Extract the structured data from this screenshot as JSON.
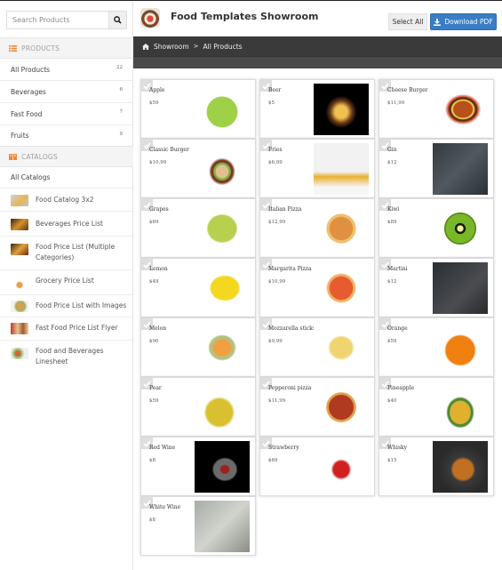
{
  "sidebar": {
    "search_placeholder": "Search Products",
    "search_icon": "search-icon",
    "products_heading": "PRODUCTS",
    "products_icon": "list-icon",
    "product_categories": [
      {
        "label": "All Products",
        "count": "22"
      },
      {
        "label": "Beverages",
        "count": "6"
      },
      {
        "label": "Fast Food",
        "count": "7"
      },
      {
        "label": "Fruits",
        "count": "9"
      }
    ],
    "catalogs_heading": "CATALOGS",
    "catalogs_icon": "book-icon",
    "all_catalogs_label": "All Catalogs",
    "catalogs": [
      {
        "label": "Food Catalog 3x2"
      },
      {
        "label": "Beverages Price List"
      },
      {
        "label": "Food Price List (Multiple Categories)"
      },
      {
        "label": "Grocery Price List"
      },
      {
        "label": "Food Price List with Images"
      },
      {
        "label": "Fast Food Price List Flyer"
      },
      {
        "label": "Food and Beverages Linesheet"
      }
    ]
  },
  "header": {
    "title": "Food Templates Showroom",
    "select_all_label": "Select All",
    "download_pdf_label": "Download PDF",
    "download_icon": "download-icon"
  },
  "breadcrumb": {
    "home_icon": "home-icon",
    "items": [
      "Showroom",
      "All Products"
    ],
    "separator": ">"
  },
  "colors": {
    "accent": "#3b7dc4",
    "header_dark": "#3a3a3a",
    "products_icon": "#f0883a",
    "catalogs_icon": "#f0883a"
  },
  "products": [
    {
      "name": "Apple",
      "price": "$59"
    },
    {
      "name": "Beer",
      "price": "$5"
    },
    {
      "name": "Cheese Burger",
      "price": "$11,99"
    },
    {
      "name": "Classic Burger",
      "price": "$10,99"
    },
    {
      "name": "Fries",
      "price": "$6,99"
    },
    {
      "name": "Gin",
      "price": "$12"
    },
    {
      "name": "Grapes",
      "price": "$69"
    },
    {
      "name": "Italian Pizza",
      "price": "$12,99"
    },
    {
      "name": "Kiwi",
      "price": "$89"
    },
    {
      "name": "Lemon",
      "price": "$49"
    },
    {
      "name": "Margarita Pizza",
      "price": "$10,99"
    },
    {
      "name": "Martini",
      "price": "$12"
    },
    {
      "name": "Melon",
      "price": "$90"
    },
    {
      "name": "Mozzarella sticks",
      "price": "$9,99"
    },
    {
      "name": "Orange",
      "price": "$59"
    },
    {
      "name": "Pear",
      "price": "$59"
    },
    {
      "name": "Pepperoni pizza",
      "price": "$11,99"
    },
    {
      "name": "Pineapple",
      "price": "$40"
    },
    {
      "name": "Red Wine",
      "price": "$8"
    },
    {
      "name": "Strawberry",
      "price": "$69"
    },
    {
      "name": "Whisky",
      "price": "$15"
    },
    {
      "name": "White Wine",
      "price": "$8"
    }
  ]
}
